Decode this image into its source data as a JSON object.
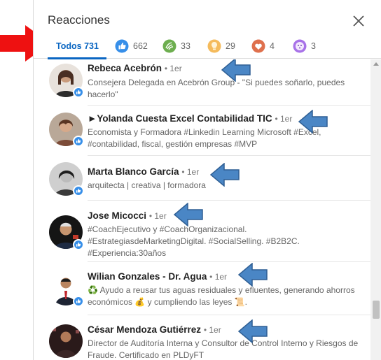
{
  "dialog": {
    "title": "Reacciones",
    "close_icon": "close-icon"
  },
  "tabs": [
    {
      "label": "Todos",
      "count": "731",
      "active": true
    },
    {
      "icon": "like-icon",
      "count": "662",
      "color": "#378fe9"
    },
    {
      "icon": "celebrate-icon",
      "count": "33",
      "color": "#44712e"
    },
    {
      "icon": "insightful-icon",
      "count": "29",
      "color": "#f5bb5c"
    },
    {
      "icon": "love-icon",
      "count": "4",
      "color": "#df704d"
    },
    {
      "icon": "curious-icon",
      "count": "3",
      "color": "#a872e8"
    }
  ],
  "people": [
    {
      "name": "Rebeca Acebrón",
      "degree": "• 1er",
      "headline": "Consejera Delegada en Acebrón Group - \"Si puedes soñarlo, puedes hacerlo\"",
      "reaction": "like"
    },
    {
      "name": "►Yolanda Cuesta Excel Contabilidad TIC",
      "degree": "• 1er",
      "headline": "Economista y Formadora #Linkedin Learning Microsoft #Excel, #contabilidad, fiscal, gestión empresas #MVP",
      "reaction": "like"
    },
    {
      "name": "Marta Blanco García",
      "degree": "• 1er",
      "headline": "arquitecta | creativa | formadora",
      "reaction": "like"
    },
    {
      "name": "Jose Micocci",
      "degree": "• 1er",
      "headline": "#CoachEjecutivo y #CoachOrganizacional. #EstrategiasdeMarketingDigital. #SocialSelling. #B2B2C. #Experiencia:30años",
      "reaction": "like"
    },
    {
      "name": "Wilian Gonzales - Dr. Agua",
      "degree": "• 1er",
      "headline": "♻️ Ayudo a reusar tus aguas residuales y efluentes, generando ahorros económicos 💰 y cumpliendo las leyes 📜.",
      "reaction": "like"
    },
    {
      "name": "César Mendoza Gutiérrez",
      "degree": "• 1er",
      "headline": "Director de Auditoría Interna y Consultor de Control Interno y Riesgos de Fraude. Certificado en PLDyFT",
      "reaction": "like"
    }
  ],
  "colors": {
    "accent": "#0a66c2",
    "like_badge": "#378fe9",
    "annotation_blue": "#4a86c5",
    "annotation_red": "#ee1111"
  }
}
